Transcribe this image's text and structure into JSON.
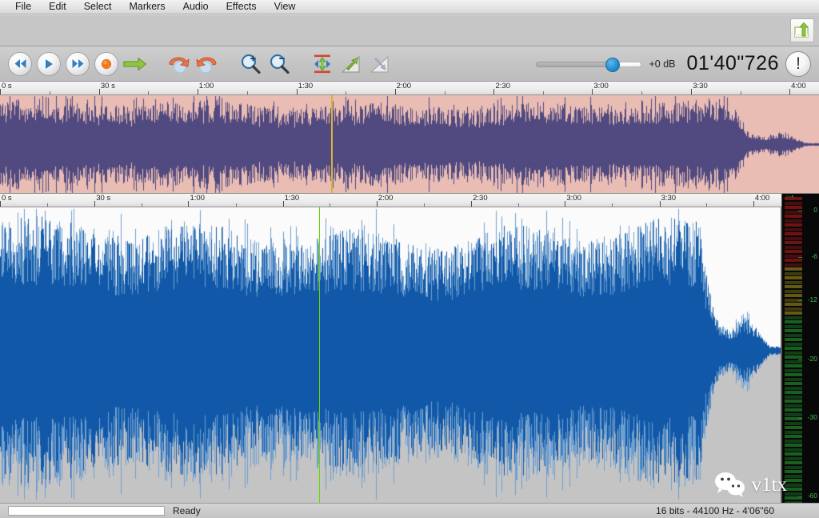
{
  "menu": {
    "items": [
      {
        "label": "File"
      },
      {
        "label": "Edit"
      },
      {
        "label": "Select"
      },
      {
        "label": "Markers"
      },
      {
        "label": "Audio"
      },
      {
        "label": "Effects"
      },
      {
        "label": "View"
      }
    ]
  },
  "topstrip": {
    "export_icon": "export-arrow-icon"
  },
  "toolbar": {
    "transport": [
      {
        "name": "rewind-button",
        "icon": "rewind-icon"
      },
      {
        "name": "play-button",
        "icon": "play-icon"
      },
      {
        "name": "fast-forward-button",
        "icon": "fast-forward-icon"
      },
      {
        "name": "record-button",
        "icon": "record-icon"
      },
      {
        "name": "go-to-end-button",
        "icon": "green-arrow-right-icon"
      }
    ],
    "edit": [
      {
        "name": "undo-button",
        "icon": "undo-icon"
      },
      {
        "name": "redo-button",
        "icon": "redo-icon"
      }
    ],
    "zoom": [
      {
        "name": "zoom-in-button",
        "icon": "magnifier-plus-icon"
      },
      {
        "name": "zoom-out-button",
        "icon": "magnifier-minus-icon"
      },
      {
        "name": "zoom-fit-vertical-button",
        "icon": "fit-vertical-icon"
      },
      {
        "name": "amplify-button",
        "icon": "green-up-arrow-chart-icon"
      },
      {
        "name": "fade-button",
        "icon": "fade-chart-icon"
      }
    ],
    "volume": {
      "label": "+0 dB",
      "value_percent": 72
    },
    "time_display": "01'40\"726",
    "info_button": {
      "label": "!",
      "icon": "exclamation-circle-icon"
    },
    "accent_color": "#2490d2"
  },
  "ruler": {
    "labels": [
      "0 s",
      "30 s",
      "1:00",
      "1:30",
      "2:00",
      "2:30",
      "3:00",
      "3:30",
      "4:00"
    ],
    "positions_percent": [
      0,
      12.1,
      24.1,
      36.2,
      48.2,
      60.3,
      72.3,
      84.4,
      96.4
    ]
  },
  "overview": {
    "name": "overview-waveform",
    "background_color": "#eabdb4",
    "wave_color": "#514a80",
    "cursor_position_percent": 40.4,
    "cursor_color": "#d8b23a"
  },
  "mainwave": {
    "name": "main-waveform",
    "background_top_color": "#fbfbfb",
    "background_bottom_color": "#c4c4c4",
    "wave_color": "#1159a8",
    "playhead_position_percent": 40.8,
    "playhead_color": "#6dd400"
  },
  "vumeter": {
    "name": "vu-meter",
    "inf_label": "-inf",
    "scale_labels": [
      "0",
      "-6",
      "-12",
      "-20",
      "-30",
      "-60"
    ],
    "scale_positions_percent": [
      5.5,
      20.5,
      34.5,
      53.5,
      72.5,
      98.0
    ],
    "colors": {
      "red": "#7a1414",
      "yellow": "#6f6417",
      "green": "#1b6a24",
      "text": "#35c24b"
    }
  },
  "statusbar": {
    "progress_percent": 0,
    "status_text": "Ready",
    "file_info": "16 bits - 44100 Hz - 4'06\"60"
  },
  "watermark": {
    "text": "v1tx",
    "icon": "wechat-icon"
  }
}
